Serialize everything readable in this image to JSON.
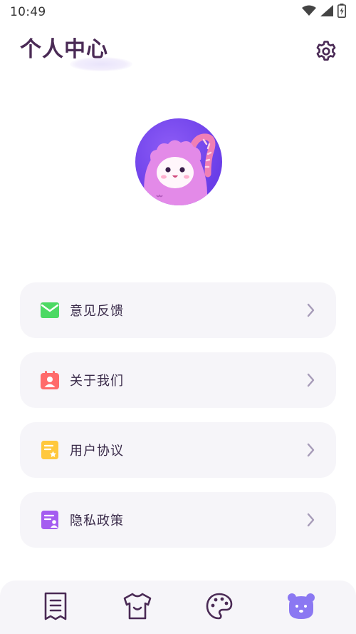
{
  "status_bar": {
    "time": "10:49",
    "icons": [
      "wifi-icon",
      "signal-icon",
      "battery-icon"
    ]
  },
  "header": {
    "title": "个人中心",
    "settings_icon": "gear-icon"
  },
  "avatar": {
    "icon": "monster-avatar"
  },
  "menu": {
    "items": [
      {
        "label": "意见反馈",
        "icon": "mail-icon",
        "color": "#4cd964"
      },
      {
        "label": "关于我们",
        "icon": "contact-card-icon",
        "color": "#ff6b6b"
      },
      {
        "label": "用户协议",
        "icon": "document-star-icon",
        "color": "#ffc83d"
      },
      {
        "label": "隐私政策",
        "icon": "privacy-document-icon",
        "color": "#a45cf0"
      }
    ]
  },
  "bottom_nav": {
    "items": [
      {
        "icon": "receipt-icon",
        "active": false
      },
      {
        "icon": "tshirt-icon",
        "active": false
      },
      {
        "icon": "palette-icon",
        "active": false
      },
      {
        "icon": "bear-icon",
        "active": true
      }
    ],
    "active_color": "#8b78f2",
    "inactive_color": "#4a2a55"
  },
  "colors": {
    "title": "#4a2a55",
    "card_bg": "#f6f5f9",
    "avatar_bg": "#6a3ee8"
  }
}
